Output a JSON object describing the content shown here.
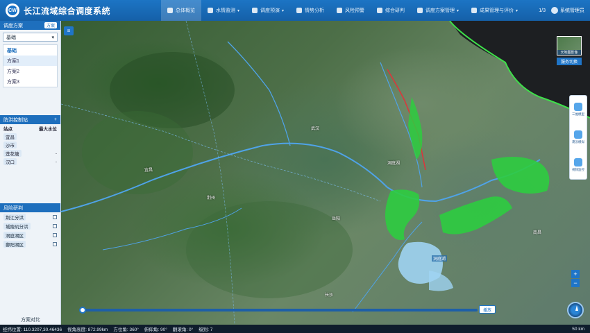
{
  "app": {
    "title": "长江流域综合调度系统",
    "logo_text": "CW"
  },
  "nav": [
    {
      "label": "总体概览",
      "active": true,
      "dropdown": false
    },
    {
      "label": "水情监测",
      "active": false,
      "dropdown": true
    },
    {
      "label": "调度预演",
      "active": false,
      "dropdown": true
    },
    {
      "label": "情势分析",
      "active": false,
      "dropdown": false
    },
    {
      "label": "风险预警",
      "active": false,
      "dropdown": false
    },
    {
      "label": "综合研判",
      "active": false,
      "dropdown": false
    },
    {
      "label": "调度方案管理",
      "active": false,
      "dropdown": true
    },
    {
      "label": "成果管理与评价",
      "active": false,
      "dropdown": true
    }
  ],
  "topright": {
    "page_indicator": "1/3",
    "user": "系统管理员"
  },
  "left": {
    "scheme_section": {
      "title": "调度方案",
      "tag": "方案"
    },
    "select_value": "基础",
    "dropdown_options": [
      {
        "label": "基础",
        "selected": true,
        "hover": false
      },
      {
        "label": "方案1",
        "selected": false,
        "hover": true
      },
      {
        "label": "方案2",
        "selected": false,
        "hover": false
      },
      {
        "label": "方案3",
        "selected": false,
        "hover": false
      }
    ],
    "flood_section": {
      "title": "防洪控制站",
      "tag": "+"
    },
    "flood_table": {
      "headers": [
        "站点",
        "最大水位"
      ],
      "rows": [
        {
          "name": "宜昌",
          "value": ""
        },
        {
          "name": "沙市",
          "value": ""
        },
        {
          "name": "莲花塘",
          "value": "-"
        },
        {
          "name": "汉口",
          "value": "-"
        }
      ]
    },
    "risk_section": {
      "title": "风险研判"
    },
    "risk_list": [
      {
        "label": "荆江分洪",
        "checked": false
      },
      {
        "label": "城陵矶分洪",
        "checked": false
      },
      {
        "label": "洞庭湖区",
        "checked": false
      },
      {
        "label": "鄱阳湖区",
        "checked": false
      }
    ],
    "footer_label": "方案对比"
  },
  "map": {
    "places": [
      "武汉",
      "宜昌",
      "荆州",
      "岳阳",
      "长沙",
      "南昌",
      "洞庭湖"
    ],
    "lake_label": "洞庭湖"
  },
  "right_tools": {
    "basemap_thumb_label": "天地图影像",
    "basemap_button": "服务切换",
    "tools": [
      {
        "label": "三维模型"
      },
      {
        "label": "淹没模拟"
      },
      {
        "label": "视频监控"
      }
    ],
    "zoom_in": "+",
    "zoom_out": "−"
  },
  "timeline": {
    "play_label": "播放",
    "progress": 0.0
  },
  "status": {
    "position": "经纬位置: 110.3207,30.46436",
    "altitude": "视角高度: 872.99km",
    "heading": "方位角: 360°",
    "pitch": "俯仰角: 90°",
    "roll": "翻滚角: 0°",
    "level": "级别: 7",
    "scale": "50 km"
  },
  "colors": {
    "header": "#1c74c4",
    "accent": "#1e6fbd",
    "flood_zone": "#2ecc40",
    "river": "#4fa3e8"
  }
}
